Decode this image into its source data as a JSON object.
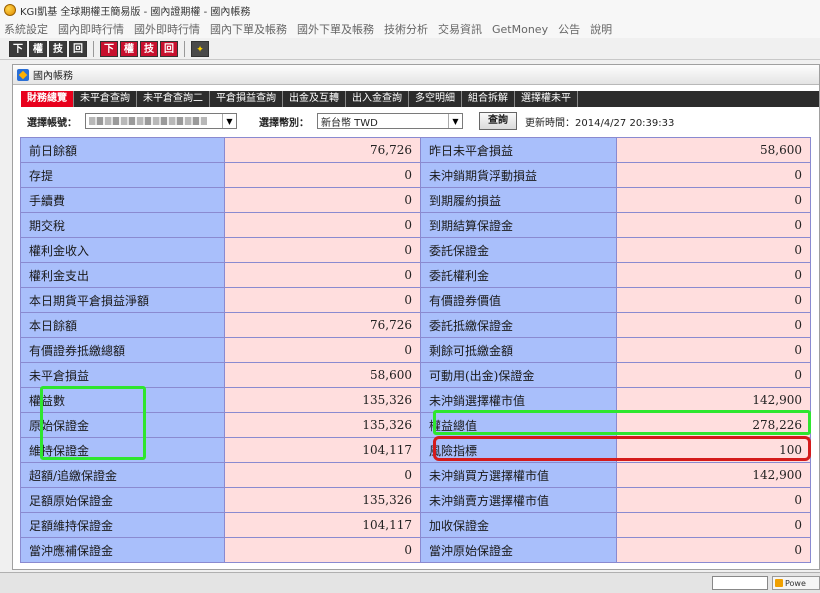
{
  "window": {
    "title": "KGI凱基 全球期權王簡易版 - 國內證期權 - 國內帳務"
  },
  "menu": [
    "系統設定",
    "國內即時行情",
    "國外即時行情",
    "國內下單及帳務",
    "國外下單及帳務",
    "技術分析",
    "交易資訊",
    "GetMoney",
    "公告",
    "說明"
  ],
  "toolbar": {
    "buttons": [
      "下",
      "權",
      "技",
      "回",
      "下",
      "權",
      "技",
      "回"
    ]
  },
  "panel": {
    "title": "國內帳務"
  },
  "tabs": [
    {
      "label": "財務總覽",
      "active": true
    },
    {
      "label": "未平倉查詢"
    },
    {
      "label": "未平倉查詢二"
    },
    {
      "label": "平倉損益查詢"
    },
    {
      "label": "出金及互轉"
    },
    {
      "label": "出入金查詢"
    },
    {
      "label": "多空明細"
    },
    {
      "label": "組合拆解"
    },
    {
      "label": "選擇權未平"
    }
  ],
  "filters": {
    "account_label": "選擇帳號：",
    "currency_label": "選擇幣別：",
    "currency_value": "新台幣 TWD",
    "query_button": "查詢",
    "update_time": "更新時間：2014/4/27 20:39:33"
  },
  "rows": [
    {
      "l1": "前日餘額",
      "v1": "76,726",
      "l2": "昨日未平倉損益",
      "v2": "58,600"
    },
    {
      "l1": "存提",
      "v1": "0",
      "l2": "未沖銷期貨浮動損益",
      "v2": "0"
    },
    {
      "l1": "手續費",
      "v1": "0",
      "l2": "到期履約損益",
      "v2": "0"
    },
    {
      "l1": "期交稅",
      "v1": "0",
      "l2": "到期結算保證金",
      "v2": "0"
    },
    {
      "l1": "權利金收入",
      "v1": "0",
      "l2": "委託保證金",
      "v2": "0"
    },
    {
      "l1": "權利金支出",
      "v1": "0",
      "l2": "委託權利金",
      "v2": "0"
    },
    {
      "l1": "本日期貨平倉損益淨額",
      "v1": "0",
      "l2": "有價證券價值",
      "v2": "0"
    },
    {
      "l1": "本日餘額",
      "v1": "76,726",
      "l2": "委託抵繳保證金",
      "v2": "0"
    },
    {
      "l1": "有價證券抵繳總額",
      "v1": "0",
      "l2": "剩餘可抵繳金額",
      "v2": "0"
    },
    {
      "l1": "未平倉損益",
      "v1": "58,600",
      "l2": "可動用(出金)保證金",
      "v2": "0"
    },
    {
      "l1": "權益數",
      "v1": "135,326",
      "l2": "未沖銷選擇權市值",
      "v2": "142,900"
    },
    {
      "l1": "原始保證金",
      "v1": "135,326",
      "l2": "權益總值",
      "v2": "278,226"
    },
    {
      "l1": "維持保證金",
      "v1": "104,117",
      "l2": "風險指標",
      "v2": "100"
    },
    {
      "l1": "超額/追繳保證金",
      "v1": "0",
      "l2": "未沖銷買方選擇權市值",
      "v2": "142,900"
    },
    {
      "l1": "足額原始保證金",
      "v1": "135,326",
      "l2": "未沖銷賣方選擇權市值",
      "v2": "0"
    },
    {
      "l1": "足額維持保證金",
      "v1": "104,117",
      "l2": "加收保證金",
      "v2": "0"
    },
    {
      "l1": "當沖應補保證金",
      "v1": "0",
      "l2": "當沖原始保證金",
      "v2": "0"
    }
  ],
  "statusbar": {
    "badge": "Powe"
  },
  "colors": {
    "label_bg": "#a9bffb",
    "value_bg": "#ffdede",
    "tab_active": "#e8001c",
    "highlight_green": "#2ee62e",
    "highlight_red": "#d41b1b"
  }
}
